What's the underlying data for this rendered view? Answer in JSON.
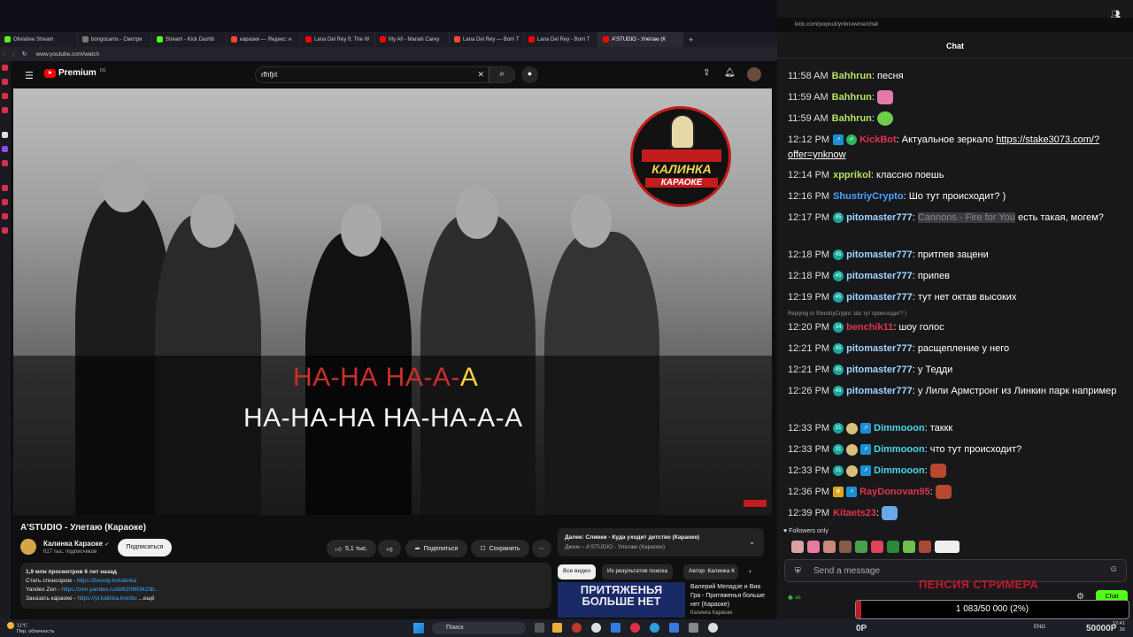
{
  "browser": {
    "tabs": [
      {
        "label": "OliviaIive Stream",
        "color": "#53fc18"
      },
      {
        "label": "bongocams - Смотри",
        "color": "#777777"
      },
      {
        "label": "Stream - Kick Dashb",
        "color": "#53fc18"
      },
      {
        "label": "караоке — Яндекс: н",
        "color": "#ff4433"
      },
      {
        "label": "Lana Del Rey ft. The W",
        "color": "#ff0000"
      },
      {
        "label": "My All - Mariah Carey",
        "color": "#ff0000"
      },
      {
        "label": "Lana Del Rey — Born T",
        "color": "#ff4433"
      },
      {
        "label": "Lana Del Rey - Born T",
        "color": "#ff0000"
      },
      {
        "label": "A'STUDIO - Улетаю (К",
        "color": "#ff0000"
      }
    ],
    "url": "www.youtube.com/watch"
  },
  "youtube": {
    "logo_text": "Premium",
    "logo_region": "DE",
    "search_value": "rfhfjrt",
    "lyrics": {
      "line1_main": "НА-НА НА-А-",
      "line1_tail": "А",
      "line2": "НА-НА-НА НА-НА-А-А"
    },
    "overlay_logo": {
      "name": "КАЛИНКА",
      "sub": "КАРАОКЕ"
    },
    "video_title": "A'STUDIO - Улетаю (Караоке)",
    "channel": {
      "name": "Калинка Караоке",
      "verified": "✔",
      "subs": "617 тыс. подписчиков"
    },
    "subscribe_label": "Подписаться",
    "actions": {
      "likes": "5,1 тыс.",
      "share": "Поделиться",
      "save": "Сохранить"
    },
    "description": {
      "stats": "1,9 млн просмотров  6 лет назад",
      "line2_label": "Стать спонсором - ",
      "line2_link": "https://boosty.to/kalinka",
      "line3_label": "Yandex Zen - ",
      "line3_link": "https://zen.yandex.ru/id/620f6f3423b...",
      "line4_label": "Заказать караоке - ",
      "line4_link": "https://yt.kalinka.live/bu",
      "more": "...ещё"
    },
    "next_up": {
      "title": "Далее: Сливки - Куда уходит детство (Караоке)",
      "sub": "Джем – A'STUDIO - Улетаю (Караоке)"
    },
    "chips": [
      "Все видео",
      "Из результатов поиска",
      "Автор: Калинка К"
    ],
    "recommended": {
      "thumb_text": "ПРИТЯЖЕНЬЯ БОЛЬШЕ НЕТ",
      "title": "Валерий Меладзе и Виа Гра - Притяженья больше нет (Караоке)",
      "channel": "Калинка Караоке"
    }
  },
  "chat": {
    "url": "kick.com/popout/ynknowme/chat",
    "title": "Chat",
    "messages": [
      {
        "time": "11:58 AM",
        "user": "Bahhrun",
        "color": "#b4e061",
        "text": "песня"
      },
      {
        "time": "11:59 AM",
        "user": "Bahhrun",
        "color": "#b4e061",
        "text": ""
      },
      {
        "time": "11:59 AM",
        "user": "Bahhrun",
        "color": "#b4e061",
        "text": ""
      },
      {
        "time": "12:12 PM",
        "user": "KickBot",
        "color": "#e0344a",
        "text": "Актуальное зеркало ",
        "link": "https://stake3073.com/?offer=ynknow"
      },
      {
        "time": "12:14 PM",
        "user": "xpprikol",
        "color": "#b4e061",
        "text": "классно поешь"
      },
      {
        "time": "12:16 PM",
        "user": "ShustriyCrypto",
        "color": "#4aa3ff",
        "text": "Шо тут происходит? )"
      },
      {
        "time": "12:17 PM",
        "user": "pitomaster777",
        "color": "#9fd4ff",
        "badge": "45",
        "highlight": "Cannons - Fire for You",
        "text": " есть такая, могем?"
      },
      {
        "time": "12:18 PM",
        "user": "pitomaster777",
        "color": "#9fd4ff",
        "badge": "45",
        "text": "притпев зацени"
      },
      {
        "time": "12:18 PM",
        "user": "pitomaster777",
        "color": "#9fd4ff",
        "badge": "45",
        "text": "припев"
      },
      {
        "time": "12:19 PM",
        "user": "pitomaster777",
        "color": "#9fd4ff",
        "badge": "45",
        "text": "тут нет октав высоких"
      },
      {
        "time": "12:20 PM",
        "user": "benchik11",
        "color": "#e0344a",
        "badge": "34",
        "text": "шоу голос"
      },
      {
        "time": "12:21 PM",
        "user": "pitomaster777",
        "color": "#9fd4ff",
        "badge": "45",
        "text": "расщепление у него"
      },
      {
        "time": "12:21 PM",
        "user": "pitomaster777",
        "color": "#9fd4ff",
        "badge": "45",
        "text": "у Тедди"
      },
      {
        "time": "12:26 PM",
        "user": "pitomaster777",
        "color": "#9fd4ff",
        "badge": "45",
        "text": "у Лили Армстронг из Линкин парк например"
      },
      {
        "time": "12:33 PM",
        "user": "Dimmooon",
        "color": "#4ad6e8",
        "badge": "31",
        "text": "таккк"
      },
      {
        "time": "12:33 PM",
        "user": "Dimmooon",
        "color": "#4ad6e8",
        "badge": "31",
        "text": "что тут происходит?"
      },
      {
        "time": "12:33 PM",
        "user": "Dimmooon",
        "color": "#4ad6e8",
        "badge": "31",
        "text": ""
      },
      {
        "time": "12:36 PM",
        "user": "RayDonovan95",
        "color": "#e0344a",
        "text": ""
      },
      {
        "time": "12:39 PM",
        "user": "Kitaets23",
        "color": "#e0344a",
        "text": ""
      }
    ],
    "reply_note": "Replying to ShustriyCrypto: Шо тут происходит? )",
    "followers_only": "Followers only",
    "input_placeholder": "Send a message",
    "send_label": "Chat",
    "pension_label": "ПЕНСИЯ СТРИМЕРА",
    "goal": {
      "text": "1 083/50 000 (2%)",
      "progress": 0.02
    },
    "overlay_left": "0Р",
    "overlay_right": "50000Р"
  },
  "taskbar": {
    "weather_temp": "11°C",
    "weather_desc": "Пер. облачность",
    "search_label": "Поиск",
    "lang": "ENG",
    "time": "12:41",
    "date": "26"
  }
}
